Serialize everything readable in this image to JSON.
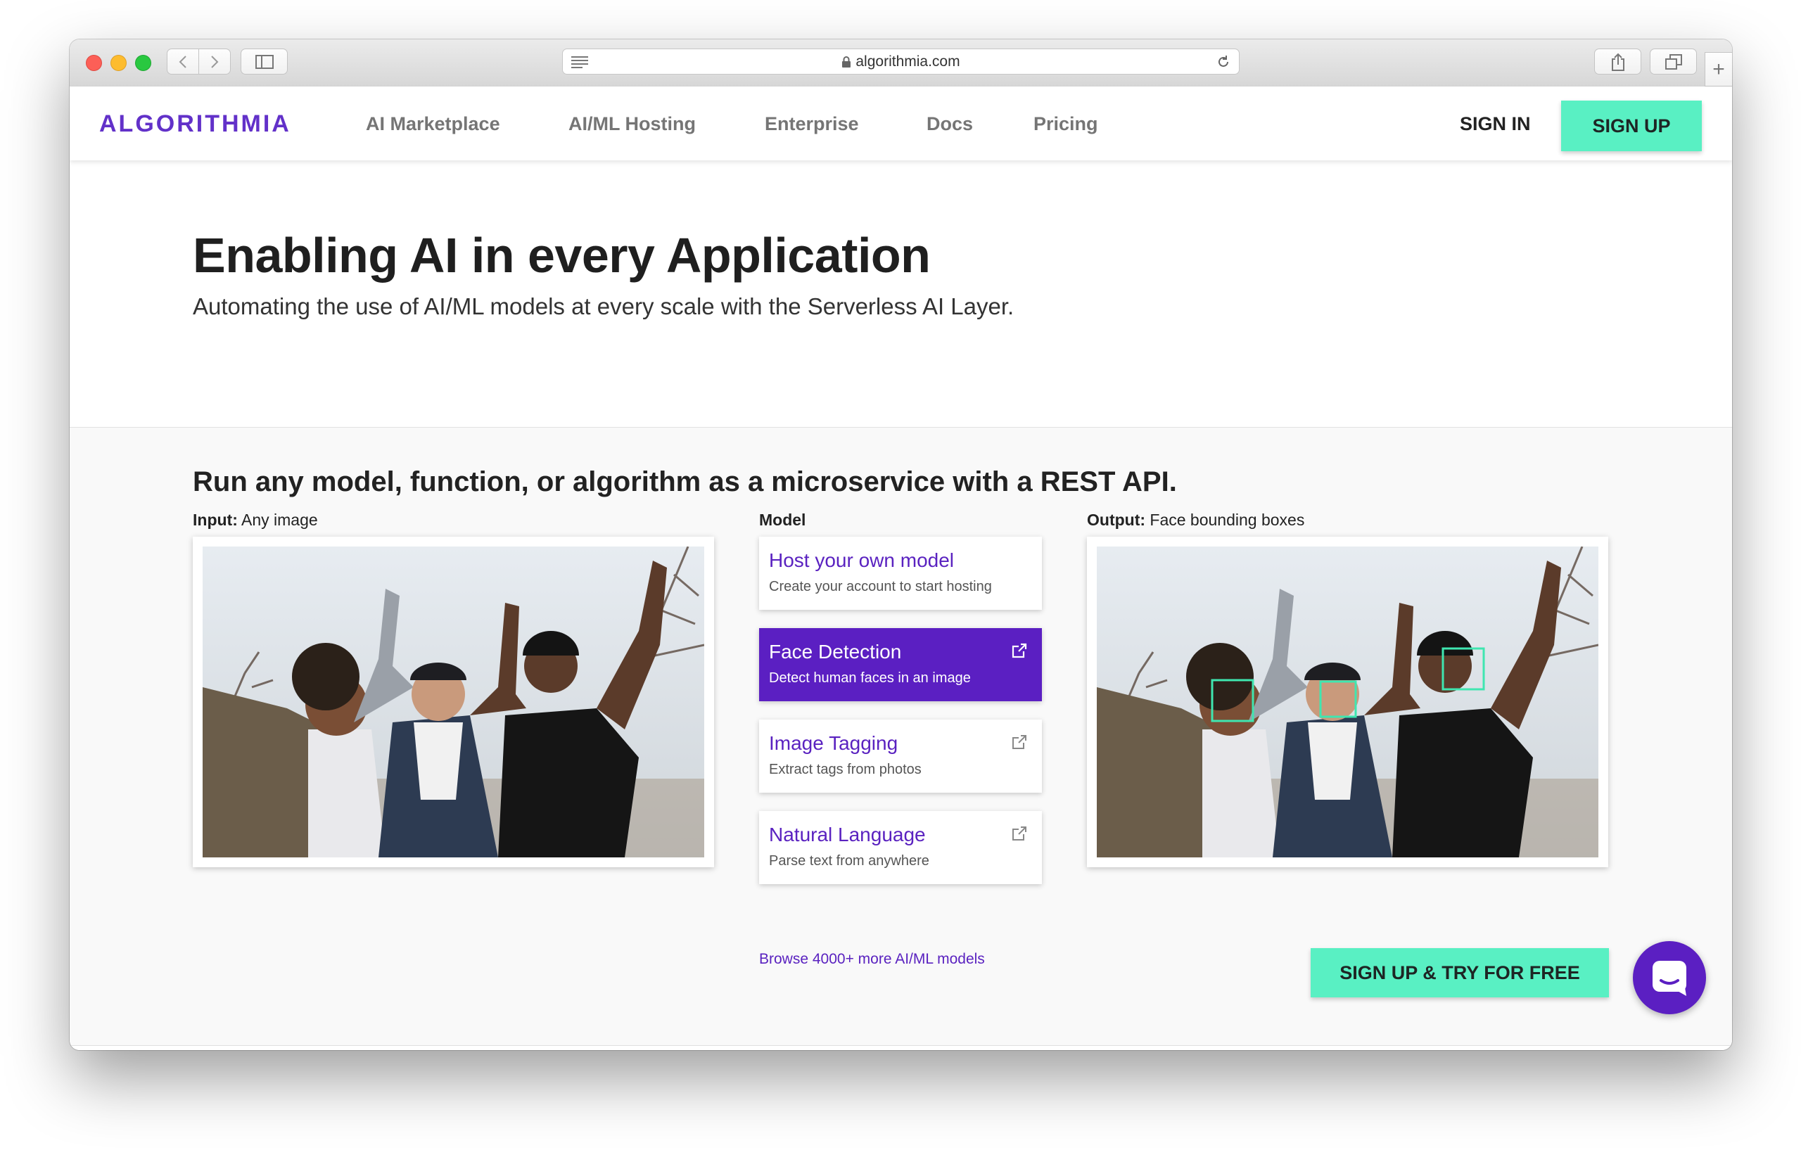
{
  "browser": {
    "url": "algorithmia.com"
  },
  "header": {
    "logo": "ALGORITHMIA",
    "nav": [
      "AI Marketplace",
      "AI/ML Hosting",
      "Enterprise",
      "Docs",
      "Pricing"
    ],
    "sign_in": "SIGN IN",
    "sign_up": "SIGN UP"
  },
  "hero": {
    "title": "Enabling AI in every Application",
    "subtitle": "Automating the use of AI/ML models at every scale with the Serverless AI Layer."
  },
  "demo": {
    "title": "Run any model, function, or algorithm as a microservice with a REST API.",
    "input_label_bold": "Input:",
    "input_label": " Any image",
    "model_label": "Model",
    "output_label_bold": "Output:",
    "output_label": " Face bounding boxes",
    "models": [
      {
        "title": "Host your own model",
        "subtitle": "Create your account to start hosting"
      },
      {
        "title": "Face Detection",
        "subtitle": "Detect human faces in an image"
      },
      {
        "title": "Image Tagging",
        "subtitle": "Extract tags from photos"
      },
      {
        "title": "Natural Language",
        "subtitle": "Parse text from anywhere"
      }
    ],
    "browse_link": "Browse 4000+ more AI/ML models",
    "cta": "SIGN UP & TRY FOR FREE"
  },
  "colors": {
    "brand_purple": "#5b1fc2",
    "accent_green": "#59f0c3",
    "face_box": "#3fe6b0"
  }
}
